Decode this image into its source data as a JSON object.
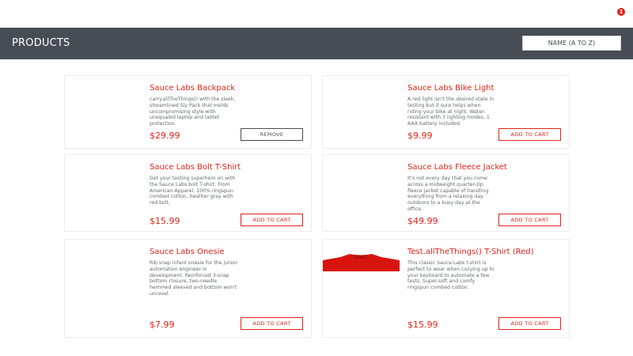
{
  "header": {
    "title": "PRODUCTS"
  },
  "cart": {
    "badge_count": "1"
  },
  "sort": {
    "selected": "NAME (A TO Z)"
  },
  "products": [
    {
      "name": "Sauce Labs Backpack",
      "description": "carry.allTheThings() with the sleek, streamlined Sly Pack that melds uncompromising style with unequaled laptop and tablet protection.",
      "price": "$29.99",
      "button": "REMOVE"
    },
    {
      "name": "Sauce Labs Bike Light",
      "description": "A red light isn't the desired state in testing but it sure helps when riding your bike at night. Water-resistant with 3 lighting modes, 1 AAA battery included.",
      "price": "$9.99",
      "button": "ADD TO CART"
    },
    {
      "name": "Sauce Labs Bolt T-Shirt",
      "description": "Get your testing superhero on with the Sauce Labs bolt T-shirt. From American Apparel, 100% ringspun combed cotton, heather gray with red bolt.",
      "price": "$15.99",
      "button": "ADD TO CART"
    },
    {
      "name": "Sauce Labs Fleece Jacket",
      "description": "It's not every day that you come across a midweight quarter-zip fleece jacket capable of handling everything from a relaxing day outdoors to a busy day at the office.",
      "price": "$49.99",
      "button": "ADD TO CART"
    },
    {
      "name": "Sauce Labs Onesie",
      "description": "Rib snap infant onesie for the junior automation engineer in development. Reinforced 3-snap bottom closure, two-needle hemmed sleeved and bottom won't unravel.",
      "price": "$7.99",
      "button": "ADD TO CART"
    },
    {
      "name": "Test.allTheThings() T-Shirt (Red)",
      "description": "This classic Sauce Labs t-shirt is perfect to wear when cozying up to your keyboard to automate a few tests. Super-soft and comfy ringspun combed cotton.",
      "price": "$15.99",
      "button": "ADD TO CART"
    }
  ],
  "colors": {
    "accent": "#e2231a",
    "header_bg": "#474c55"
  }
}
